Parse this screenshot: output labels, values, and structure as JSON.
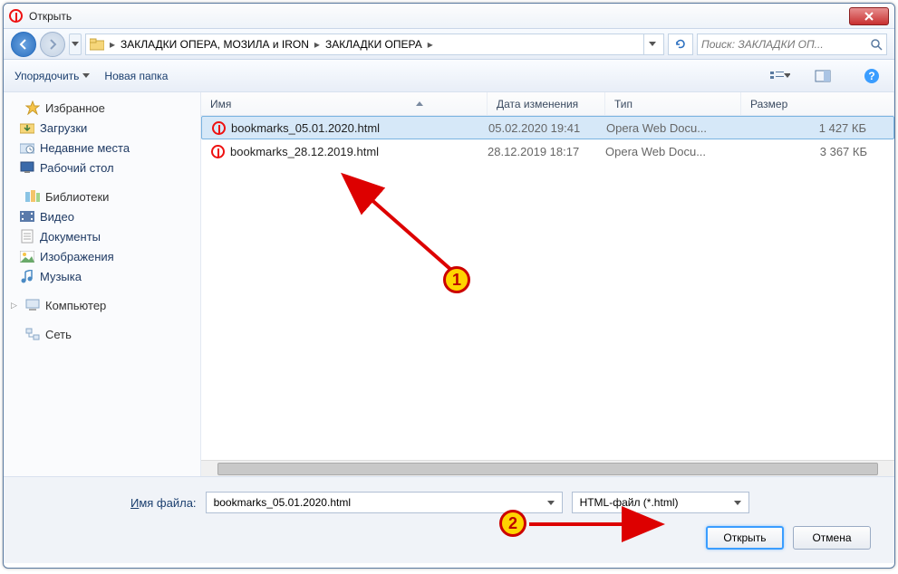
{
  "window": {
    "title": "Открыть"
  },
  "breadcrumb": {
    "parent": "ЗАКЛАДКИ ОПЕРА,  МОЗИЛА и IRON",
    "current": "ЗАКЛАДКИ ОПЕРА"
  },
  "search": {
    "placeholder": "Поиск: ЗАКЛАДКИ ОП..."
  },
  "toolbar": {
    "organize": "Упорядочить",
    "newfolder": "Новая папка"
  },
  "columns": {
    "name": "Имя",
    "date": "Дата изменения",
    "type": "Тип",
    "size": "Размер"
  },
  "sidebar": {
    "favorites": {
      "label": "Избранное",
      "items": [
        {
          "label": "Загрузки",
          "icon": "downloads"
        },
        {
          "label": "Недавние места",
          "icon": "recent"
        },
        {
          "label": "Рабочий стол",
          "icon": "desktop"
        }
      ]
    },
    "libraries": {
      "label": "Библиотеки",
      "items": [
        {
          "label": "Видео",
          "icon": "video"
        },
        {
          "label": "Документы",
          "icon": "docs"
        },
        {
          "label": "Изображения",
          "icon": "images"
        },
        {
          "label": "Музыка",
          "icon": "music"
        }
      ]
    },
    "computer": {
      "label": "Компьютер"
    },
    "network": {
      "label": "Сеть"
    }
  },
  "files": [
    {
      "name": "bookmarks_05.01.2020.html",
      "date": "05.02.2020 19:41",
      "type": "Opera Web Docu...",
      "size": "1 427 КБ",
      "selected": true
    },
    {
      "name": "bookmarks_28.12.2019.html",
      "date": "28.12.2019 18:17",
      "type": "Opera Web Docu...",
      "size": "3 367 КБ",
      "selected": false
    }
  ],
  "footer": {
    "filename_label": "Имя файла:",
    "filename_value": "bookmarks_05.01.2020.html",
    "filetype_value": "HTML-файл (*.html)",
    "open": "Открыть",
    "cancel": "Отмена"
  },
  "annotations": {
    "one": "1",
    "two": "2"
  }
}
